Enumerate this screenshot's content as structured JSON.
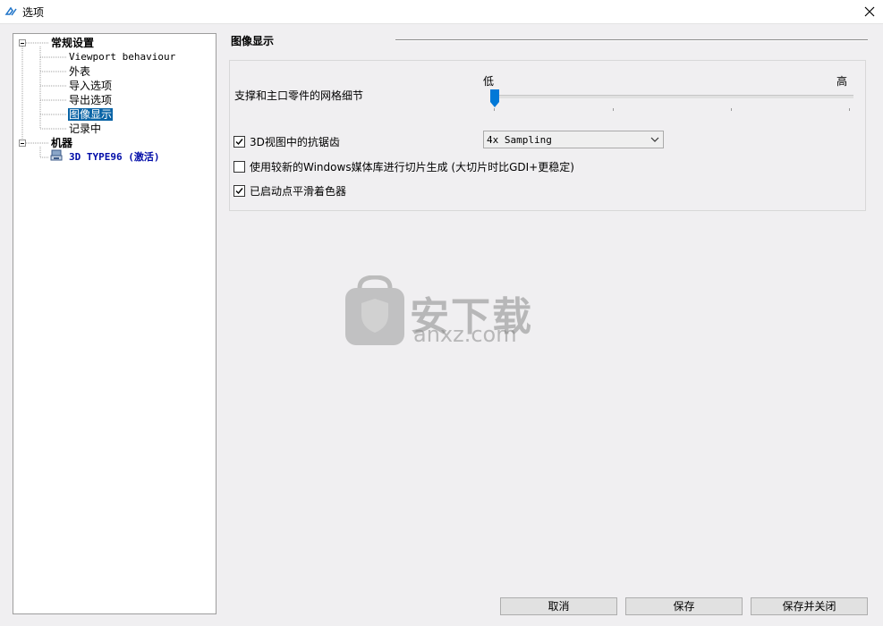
{
  "window": {
    "title": "选项"
  },
  "tree": {
    "general": "常规设置",
    "general_children": [
      "Viewport behaviour",
      "外表",
      "导入选项",
      "导出选项",
      "图像显示",
      "记录中"
    ],
    "machine": "机器",
    "machine_item": "3D TYPE96 (激活)"
  },
  "section": {
    "title": "图像显示"
  },
  "mesh": {
    "label": "支撑和主口零件的网格细节",
    "low": "低",
    "high": "高",
    "level": 0
  },
  "options": {
    "antialias": {
      "label": "3D视图中的抗锯齿",
      "checked": true
    },
    "antialias_select": "4x Sampling",
    "windows_media": {
      "label": "使用较新的Windows媒体库进行切片生成 (大切片时比GDI+更稳定)",
      "checked": false
    },
    "smooth_shader": {
      "label": "已启动点平滑着色器",
      "checked": true
    }
  },
  "watermark": {
    "cn": "安下载",
    "en": "anxz.com"
  },
  "buttons": {
    "cancel": "取消",
    "save": "保存",
    "save_close": "保存并关闭"
  },
  "colors": {
    "selection": "#0a64a6",
    "machine_text": "#000ca8",
    "slider_thumb": "#0078d7"
  }
}
